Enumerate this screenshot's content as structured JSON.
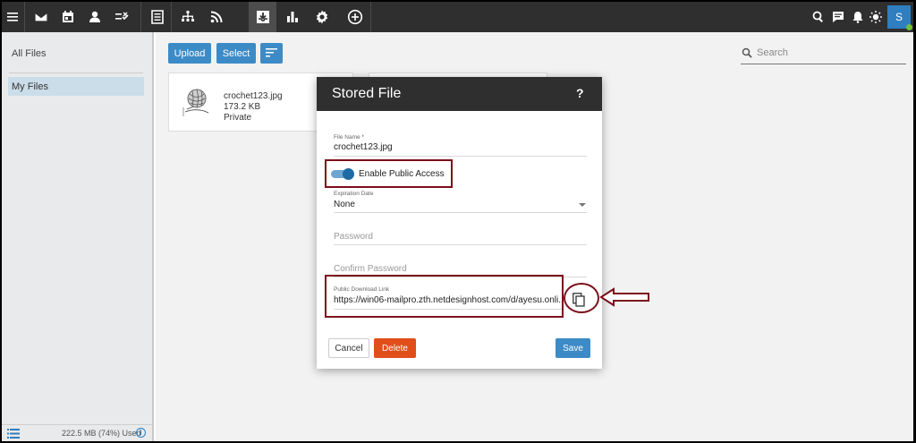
{
  "topbar": {
    "nav_icons": [
      "menu-icon",
      "mail-icon",
      "calendar-icon",
      "contacts-icon",
      "tasks-icon",
      "notes-icon",
      "org-chart-icon",
      "rss-icon",
      "file-storage-icon",
      "reports-icon",
      "settings-icon",
      "add-icon"
    ],
    "active_nav": "file-storage-icon",
    "right_icons": [
      "search-icon",
      "chat-icon",
      "bell-icon",
      "theme-icon"
    ],
    "avatar_initial": "S"
  },
  "sidebar": {
    "all_files": "All Files",
    "my_files": "My Files",
    "storage_used": "222.5 MB (74%) Used"
  },
  "toolbar": {
    "upload_label": "Upload",
    "select_label": "Select",
    "search_placeholder": "Search"
  },
  "file_card": {
    "name": "crochet123.jpg",
    "size": "173.2 KB",
    "access": "Private"
  },
  "modal": {
    "title": "Stored File",
    "help": "?",
    "file_name_label": "File Name *",
    "file_name_value": "crochet123.jpg",
    "public_access_label": "Enable Public Access",
    "public_access_on": true,
    "expiration_label": "Expiration Date",
    "expiration_value": "None",
    "password_placeholder": "Password",
    "confirm_password_placeholder": "Confirm Password",
    "download_link_label": "Public Download Link",
    "download_link_value": "https://win06-mailpro.zth.netdesignhost.com/d/ayesu.onli...",
    "cancel_label": "Cancel",
    "delete_label": "Delete",
    "save_label": "Save"
  },
  "colors": {
    "topbar": "#2f2f2f",
    "accent": "#3d8bc6",
    "delete": "#e04e1a",
    "annotation": "#7b0f1a"
  }
}
